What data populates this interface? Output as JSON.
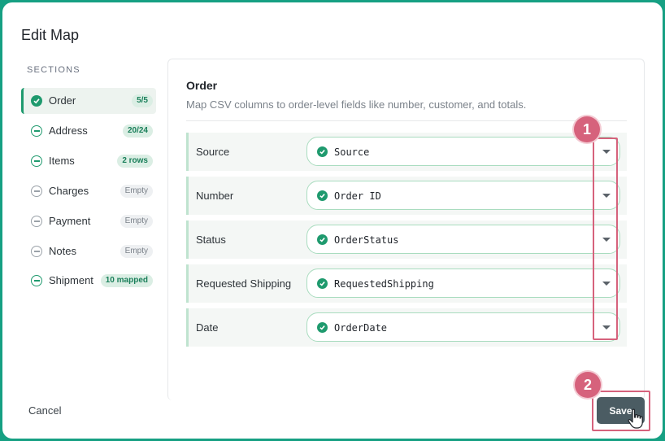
{
  "modal": {
    "title": "Edit Map"
  },
  "sidebar": {
    "heading": "SECTIONS",
    "items": [
      {
        "label": "Order",
        "badge": "5/5",
        "status": "complete"
      },
      {
        "label": "Address",
        "badge": "20/24",
        "status": "partial"
      },
      {
        "label": "Items",
        "badge": "2 rows",
        "status": "partial"
      },
      {
        "label": "Charges",
        "badge": "Empty",
        "status": "empty"
      },
      {
        "label": "Payment",
        "badge": "Empty",
        "status": "empty"
      },
      {
        "label": "Notes",
        "badge": "Empty",
        "status": "empty"
      },
      {
        "label": "Shipment",
        "badge": "10 mapped",
        "status": "partial"
      }
    ]
  },
  "panel": {
    "title": "Order",
    "description": "Map CSV columns to order-level fields like number, customer, and totals.",
    "fields": [
      {
        "label": "Source",
        "value": "Source"
      },
      {
        "label": "Number",
        "value": "Order ID"
      },
      {
        "label": "Status",
        "value": "OrderStatus"
      },
      {
        "label": "Requested Shipping",
        "value": "RequestedShipping"
      },
      {
        "label": "Date",
        "value": "OrderDate"
      }
    ]
  },
  "footer": {
    "cancel_label": "Cancel",
    "save_label": "Save"
  },
  "annotations": {
    "step1": "1",
    "step2": "2"
  },
  "colors": {
    "accent": "#1f9a6e",
    "highlight": "#d6627c",
    "save_button": "#4b5c63",
    "background": "#16a083"
  }
}
